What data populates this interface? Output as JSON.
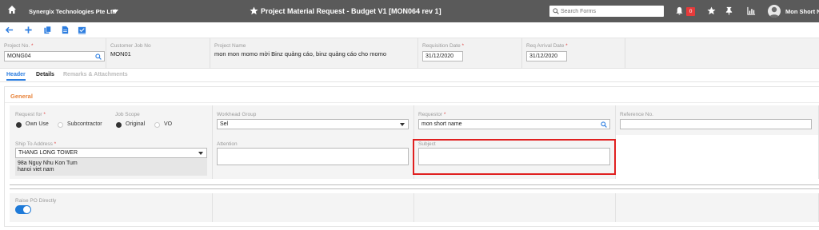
{
  "topbar": {
    "company": "Synergix Technologies Pte Ltd",
    "title": "Project Material Request - Budget V1 [MON064 rev 1]",
    "search_placeholder": "Search Forms",
    "notification_count": "0",
    "user_name": "Mon Short Name"
  },
  "info": {
    "project_no_label": "Project No.",
    "project_no_value": "MONG04",
    "customer_job_label": "Customer Job No",
    "customer_job_value": "MON01",
    "project_name_label": "Project Name",
    "project_name_value": "mon mon momo mời Binz quảng cáo, binz quảng cáo cho momo",
    "requisition_date_label": "Requisition Date",
    "requisition_date_value": "31/12/2020",
    "req_arrival_label": "Req Arrival Date",
    "req_arrival_value": "31/12/2020",
    "required_mark": "*"
  },
  "tabs": [
    {
      "label": "Header",
      "state": "active"
    },
    {
      "label": "Details",
      "state": "normal"
    },
    {
      "label": "Remarks & Attachments",
      "state": "disabled"
    }
  ],
  "general": {
    "section_title": "General",
    "request_for_label": "Request for",
    "request_for_options": [
      "Own Use",
      "Subcontractor"
    ],
    "job_scope_label": "Job Scope",
    "job_scope_options": [
      "Original",
      "VO"
    ],
    "workhead_label": "Workhead Group",
    "workhead_value": "Sel",
    "requestor_label": "Requestor",
    "requestor_value": "mon short name",
    "reference_label": "Reference No.",
    "reference_value": "",
    "ship_to_label": "Ship To Address",
    "ship_to_value": "THANG LONG TOWER",
    "address_line1": "98a Nguy Nhu Kon Tum",
    "address_line2": "hanoi viet nam",
    "attention_label": "Attention",
    "attention_value": "",
    "subject_label": "Subject",
    "subject_value": "",
    "raise_po_label": "Raise PO Directly",
    "raise_po_on": true
  },
  "colors": {
    "topbar": "#5a5a5a",
    "accent_blue": "#2d7ee0",
    "section_orange": "#e8833a",
    "highlight_red": "#e02020",
    "badge_red": "#e63b3b"
  }
}
